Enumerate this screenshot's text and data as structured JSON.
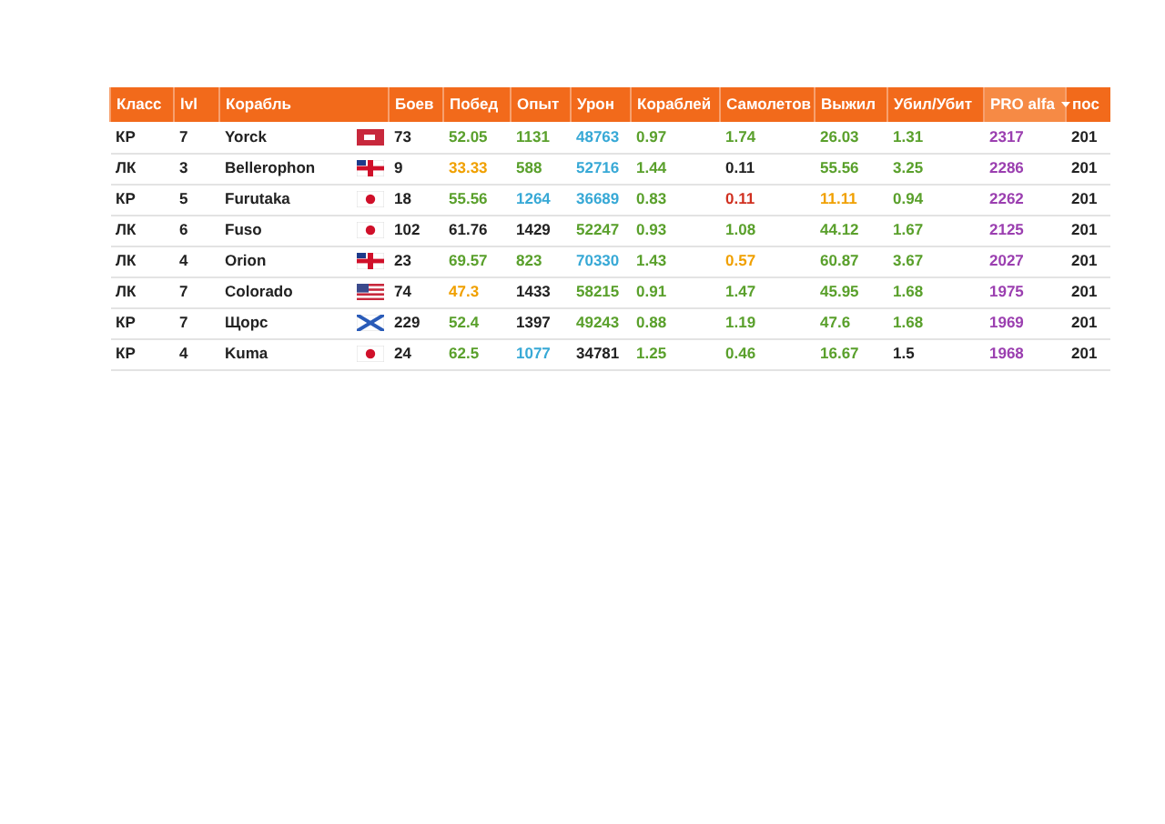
{
  "table": {
    "columns": [
      {
        "label": "Класс",
        "sorted": false
      },
      {
        "label": "lvl",
        "sorted": false
      },
      {
        "label": "Корабль",
        "sorted": false
      },
      {
        "label": "Боев",
        "sorted": false
      },
      {
        "label": "Побед",
        "sorted": false
      },
      {
        "label": "Опыт",
        "sorted": false
      },
      {
        "label": "Урон",
        "sorted": false
      },
      {
        "label": "Кораблей",
        "sorted": false
      },
      {
        "label": "Самолетов",
        "sorted": false
      },
      {
        "label": "Выжил",
        "sorted": false
      },
      {
        "label": "Убил/Убит",
        "sorted": false
      },
      {
        "label": "PRO alfa",
        "sorted": true
      },
      {
        "label": "пос",
        "sorted": false
      }
    ],
    "rows": [
      {
        "class": "КР",
        "lvl": "7",
        "ship": "Yorck",
        "flag": {
          "kind": "germany"
        },
        "stats": [
          {
            "text": "73",
            "color": "#222222"
          },
          {
            "text": "52.05",
            "color": "#5aa02c"
          },
          {
            "text": "1131",
            "color": "#5aa02c"
          },
          {
            "text": "48763",
            "color": "#38a9d6"
          },
          {
            "text": "0.97",
            "color": "#5aa02c"
          },
          {
            "text": "1.74",
            "color": "#5aa02c"
          },
          {
            "text": "26.03",
            "color": "#5aa02c"
          },
          {
            "text": "1.31",
            "color": "#5aa02c"
          },
          {
            "text": "2317",
            "color": "#9b3fb0"
          },
          {
            "text": "201",
            "color": "#222222"
          }
        ]
      },
      {
        "class": "ЛК",
        "lvl": "3",
        "ship": "Bellerophon",
        "flag": {
          "kind": "uk"
        },
        "stats": [
          {
            "text": "9",
            "color": "#222222"
          },
          {
            "text": "33.33",
            "color": "#f0a000"
          },
          {
            "text": "588",
            "color": "#5aa02c"
          },
          {
            "text": "52716",
            "color": "#38a9d6"
          },
          {
            "text": "1.44",
            "color": "#5aa02c"
          },
          {
            "text": "0.11",
            "color": "#222222"
          },
          {
            "text": "55.56",
            "color": "#5aa02c"
          },
          {
            "text": "3.25",
            "color": "#5aa02c"
          },
          {
            "text": "2286",
            "color": "#9b3fb0"
          },
          {
            "text": "201",
            "color": "#222222"
          }
        ]
      },
      {
        "class": "КР",
        "lvl": "5",
        "ship": "Furutaka",
        "flag": {
          "kind": "japan"
        },
        "stats": [
          {
            "text": "18",
            "color": "#222222"
          },
          {
            "text": "55.56",
            "color": "#5aa02c"
          },
          {
            "text": "1264",
            "color": "#38a9d6"
          },
          {
            "text": "36689",
            "color": "#38a9d6"
          },
          {
            "text": "0.83",
            "color": "#5aa02c"
          },
          {
            "text": "0.11",
            "color": "#d03020"
          },
          {
            "text": "11.11",
            "color": "#f0a000"
          },
          {
            "text": "0.94",
            "color": "#5aa02c"
          },
          {
            "text": "2262",
            "color": "#9b3fb0"
          },
          {
            "text": "201",
            "color": "#222222"
          }
        ]
      },
      {
        "class": "ЛК",
        "lvl": "6",
        "ship": "Fuso",
        "flag": {
          "kind": "japan"
        },
        "stats": [
          {
            "text": "102",
            "color": "#222222"
          },
          {
            "text": "61.76",
            "color": "#222222"
          },
          {
            "text": "1429",
            "color": "#222222"
          },
          {
            "text": "52247",
            "color": "#5aa02c"
          },
          {
            "text": "0.93",
            "color": "#5aa02c"
          },
          {
            "text": "1.08",
            "color": "#5aa02c"
          },
          {
            "text": "44.12",
            "color": "#5aa02c"
          },
          {
            "text": "1.67",
            "color": "#5aa02c"
          },
          {
            "text": "2125",
            "color": "#9b3fb0"
          },
          {
            "text": "201",
            "color": "#222222"
          }
        ]
      },
      {
        "class": "ЛК",
        "lvl": "4",
        "ship": "Orion",
        "flag": {
          "kind": "uk"
        },
        "stats": [
          {
            "text": "23",
            "color": "#222222"
          },
          {
            "text": "69.57",
            "color": "#5aa02c"
          },
          {
            "text": "823",
            "color": "#5aa02c"
          },
          {
            "text": "70330",
            "color": "#38a9d6"
          },
          {
            "text": "1.43",
            "color": "#5aa02c"
          },
          {
            "text": "0.57",
            "color": "#f0a000"
          },
          {
            "text": "60.87",
            "color": "#5aa02c"
          },
          {
            "text": "3.67",
            "color": "#5aa02c"
          },
          {
            "text": "2027",
            "color": "#9b3fb0"
          },
          {
            "text": "201",
            "color": "#222222"
          }
        ]
      },
      {
        "class": "ЛК",
        "lvl": "7",
        "ship": "Colorado",
        "flag": {
          "kind": "usa"
        },
        "stats": [
          {
            "text": "74",
            "color": "#222222"
          },
          {
            "text": "47.3",
            "color": "#f0a000"
          },
          {
            "text": "1433",
            "color": "#222222"
          },
          {
            "text": "58215",
            "color": "#5aa02c"
          },
          {
            "text": "0.91",
            "color": "#5aa02c"
          },
          {
            "text": "1.47",
            "color": "#5aa02c"
          },
          {
            "text": "45.95",
            "color": "#5aa02c"
          },
          {
            "text": "1.68",
            "color": "#5aa02c"
          },
          {
            "text": "1975",
            "color": "#9b3fb0"
          },
          {
            "text": "201",
            "color": "#222222"
          }
        ]
      },
      {
        "class": "КР",
        "lvl": "7",
        "ship": "Щорс",
        "flag": {
          "kind": "russia"
        },
        "stats": [
          {
            "text": "229",
            "color": "#222222"
          },
          {
            "text": "52.4",
            "color": "#5aa02c"
          },
          {
            "text": "1397",
            "color": "#222222"
          },
          {
            "text": "49243",
            "color": "#5aa02c"
          },
          {
            "text": "0.88",
            "color": "#5aa02c"
          },
          {
            "text": "1.19",
            "color": "#5aa02c"
          },
          {
            "text": "47.6",
            "color": "#5aa02c"
          },
          {
            "text": "1.68",
            "color": "#5aa02c"
          },
          {
            "text": "1969",
            "color": "#9b3fb0"
          },
          {
            "text": "201",
            "color": "#222222"
          }
        ]
      },
      {
        "class": "КР",
        "lvl": "4",
        "ship": "Kuma",
        "flag": {
          "kind": "japan"
        },
        "stats": [
          {
            "text": "24",
            "color": "#222222"
          },
          {
            "text": "62.5",
            "color": "#5aa02c"
          },
          {
            "text": "1077",
            "color": "#38a9d6"
          },
          {
            "text": "34781",
            "color": "#222222"
          },
          {
            "text": "1.25",
            "color": "#5aa02c"
          },
          {
            "text": "0.46",
            "color": "#5aa02c"
          },
          {
            "text": "16.67",
            "color": "#5aa02c"
          },
          {
            "text": "1.5",
            "color": "#222222"
          },
          {
            "text": "1968",
            "color": "#9b3fb0"
          },
          {
            "text": "201",
            "color": "#222222"
          }
        ]
      }
    ]
  }
}
